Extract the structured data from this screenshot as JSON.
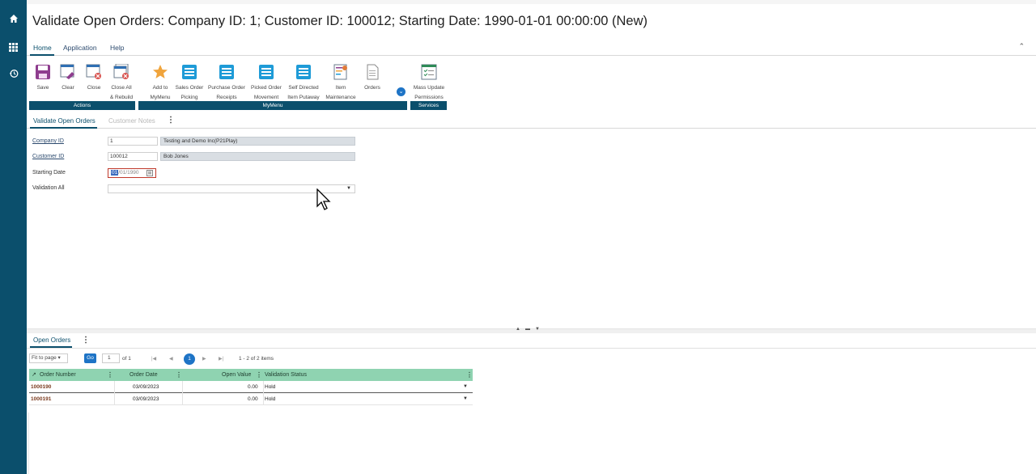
{
  "page": {
    "title": "Validate Open Orders: Company ID: 1; Customer ID: 100012; Starting Date: 1990-01-01 00:00:00 (New)"
  },
  "menu": {
    "items": [
      "Home",
      "Application",
      "Help"
    ]
  },
  "ribbon": {
    "buttons": [
      {
        "line1": "Save",
        "line2": "",
        "icon": "save-icon"
      },
      {
        "line1": "Clear",
        "line2": "",
        "icon": "clear-icon"
      },
      {
        "line1": "Close",
        "line2": "",
        "icon": "close-window-icon"
      },
      {
        "line1": "Close All",
        "line2": "& Rebuild",
        "icon": "close-all-icon"
      },
      {
        "line1": "Add to",
        "line2": "MyMenu",
        "icon": "star-icon"
      },
      {
        "line1": "Sales Order",
        "line2": "Picking",
        "icon": "window-icon"
      },
      {
        "line1": "Purchase Order",
        "line2": "Receipts",
        "icon": "window-icon"
      },
      {
        "line1": "Picked Order",
        "line2": "Movement",
        "icon": "window-icon"
      },
      {
        "line1": "Self Directed",
        "line2": "Item Putaway",
        "icon": "window-icon"
      },
      {
        "line1": "Item",
        "line2": "Maintenance",
        "icon": "item-maintenance-icon"
      },
      {
        "line1": "Orders",
        "line2": "",
        "icon": "document-icon"
      },
      {
        "line1": "Mass Update",
        "line2": "Permissions",
        "icon": "checklist-icon"
      }
    ],
    "groups": [
      "Actions",
      "MyMenu",
      "Services"
    ]
  },
  "tabs": {
    "active": "Validate Open Orders",
    "inactive": "Customer Notes"
  },
  "form": {
    "company_id_label": "Company ID",
    "company_id_value": "1",
    "company_name": "Testing and Demo Inc(P21Play)",
    "customer_id_label": "Customer ID",
    "customer_id_value": "100012",
    "customer_name": "Bob Jones",
    "starting_date_label": "Starting Date",
    "starting_date_selected": "01",
    "starting_date_rest": "/01/1990",
    "validation_all_label": "Validation All",
    "validation_all_value": ""
  },
  "open_orders": {
    "tab_label": "Open Orders",
    "fit_to_page": "Fit to page",
    "go_label": "Go",
    "page_input": "1",
    "of_pages": "of 1",
    "current_page": "1",
    "items_text": "1 - 2 of 2 items",
    "columns": [
      "Order Number",
      "Order Date",
      "Open Value",
      "Validation Status"
    ],
    "rows": [
      {
        "order_number": "1000190",
        "order_date": "03/09/2023",
        "open_value": "0.00",
        "status": "Hold"
      },
      {
        "order_number": "1000191",
        "order_date": "03/09/2023",
        "open_value": "0.00",
        "status": "Hold"
      }
    ]
  }
}
